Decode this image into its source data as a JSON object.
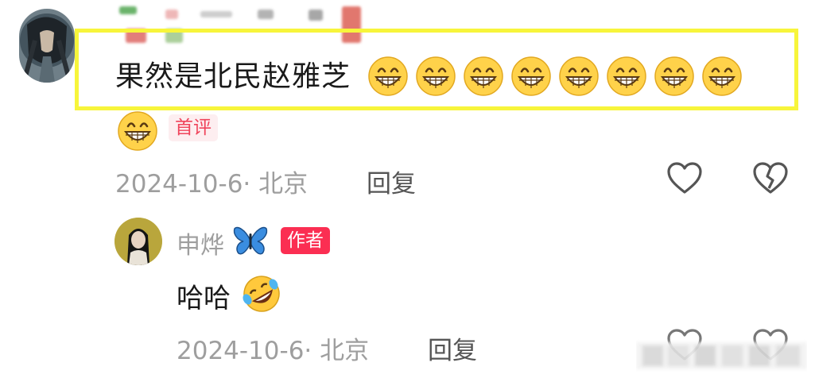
{
  "comment": {
    "text": "果然是北民赵雅芝",
    "emoji_icon": "grinning-face-emoji",
    "emoji_count": 9,
    "badge": "首评",
    "date_location": "2024-10-6· 北京",
    "reply_label": "回复"
  },
  "reply": {
    "username": "申烨",
    "username_icon": "butterfly-emoji",
    "badge": "作者",
    "text": "哈哈",
    "text_emoji_icon": "rolling-laughing-emoji",
    "date_location": "2024-10-6· 北京",
    "reply_label": "回复"
  },
  "icons": {
    "like": "heart-outline-icon",
    "dislike": "broken-heart-outline-icon"
  },
  "colors": {
    "highlight": "#f7f53b",
    "author_badge": "#fb2e52",
    "first_badge_text": "#f0445b",
    "meta_text": "#9e9e9e"
  }
}
